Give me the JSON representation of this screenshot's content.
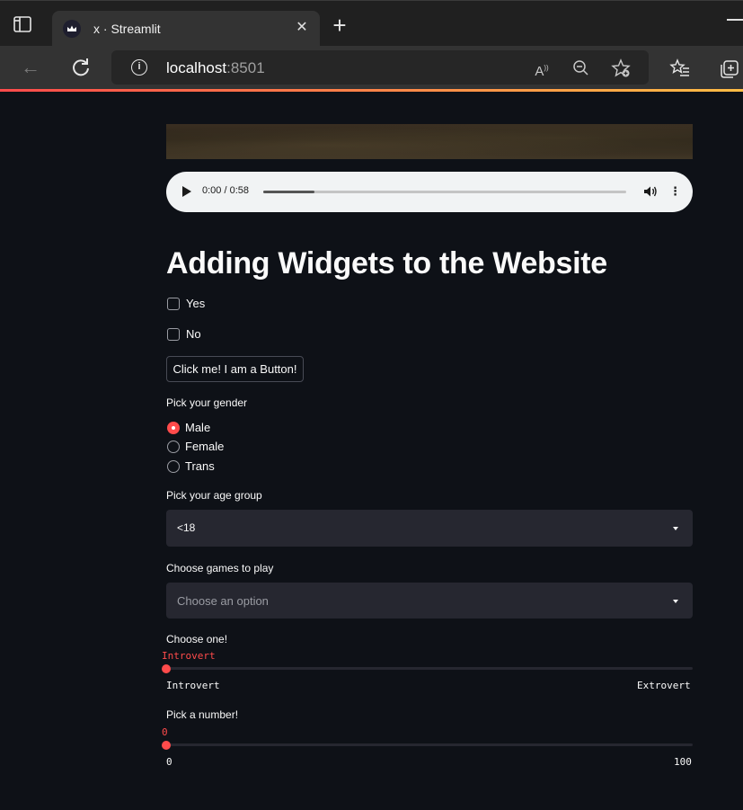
{
  "browser": {
    "tab_title": "x · Streamlit",
    "url_host": "localhost",
    "url_port": ":8501"
  },
  "audio": {
    "time": "0:00 / 0:58",
    "progress": 0.14
  },
  "page": {
    "title": "Adding Widgets to the Website"
  },
  "checkboxes": [
    {
      "label": "Yes",
      "checked": false
    },
    {
      "label": "No",
      "checked": false
    }
  ],
  "button": {
    "label": "Click me! I am a Button!"
  },
  "gender": {
    "label": "Pick your gender",
    "options": [
      "Male",
      "Female",
      "Trans"
    ],
    "selected": "Male"
  },
  "age": {
    "label": "Pick your age group",
    "value": "<18"
  },
  "games": {
    "label": "Choose games to play",
    "placeholder": "Choose an option"
  },
  "personality": {
    "label": "Choose one!",
    "value": "Introvert",
    "min_label": "Introvert",
    "max_label": "Extrovert"
  },
  "number": {
    "label": "Pick a number!",
    "value": "0",
    "min_label": "0",
    "max_label": "100"
  },
  "colors": {
    "accent": "#ff4b4b",
    "background": "#0e1117",
    "widget_bg": "#262730"
  }
}
